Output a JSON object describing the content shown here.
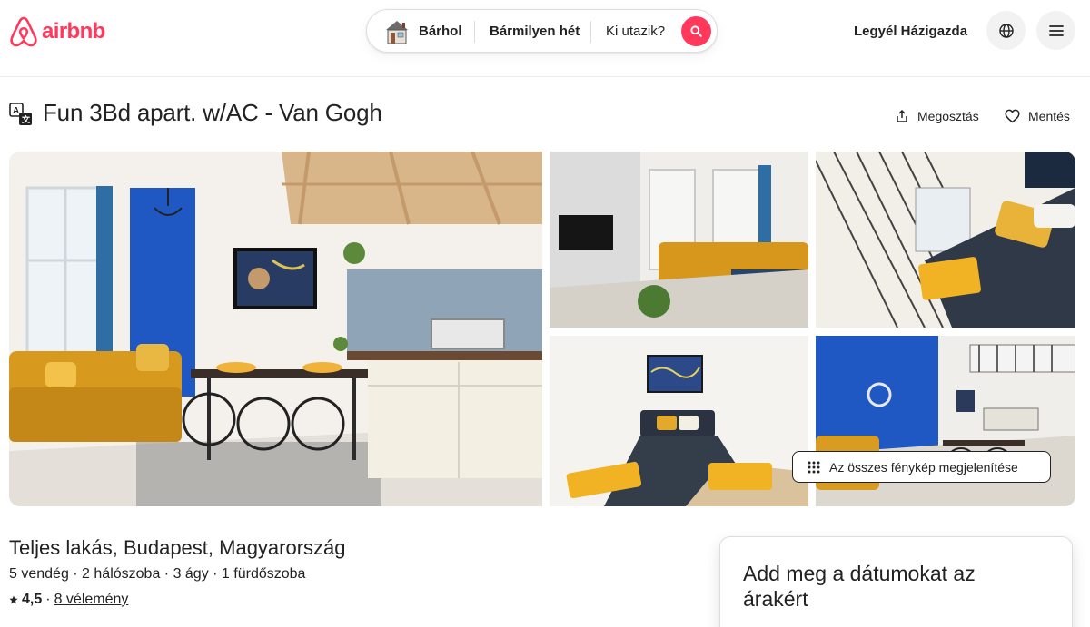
{
  "header": {
    "brand": "airbnb",
    "search": {
      "where": "Bárhol",
      "when": "Bármilyen hét",
      "who": "Ki utazik?"
    },
    "host_label": "Legyél Házigazda"
  },
  "listing": {
    "title": "Fun 3Bd apart. w/AC - Van Gogh",
    "share_label": "Megosztás",
    "save_label": "Mentés",
    "show_all_photos": "Az összes fénykép megjelenítése",
    "location_title": "Teljes lakás, Budapest, Magyarország",
    "specs": "5 vendég · 2 hálószoba · 3 ágy · 1 fürdőszoba",
    "rating": "4,5",
    "rating_separator": "·",
    "reviews": "8 vélemény"
  },
  "booking": {
    "prompt": "Add meg a dátumokat az árakért"
  },
  "colors": {
    "brand": "#FF385C",
    "text": "#222222",
    "muted": "#717171"
  }
}
